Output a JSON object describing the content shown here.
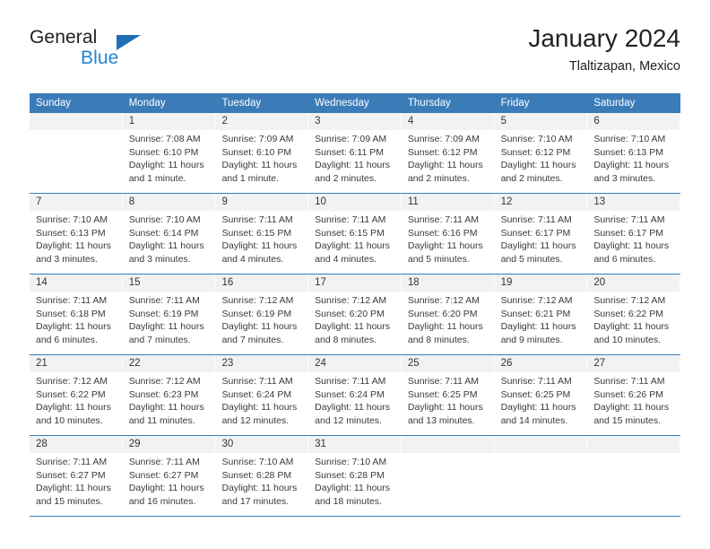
{
  "brand": {
    "name_top": "General",
    "name_bottom": "Blue",
    "triangle_color": "#1f6fb5",
    "blue_color": "#2185d0"
  },
  "header": {
    "title": "January 2024",
    "subtitle": "Tlaltizapan, Mexico"
  },
  "calendar": {
    "header_bg": "#3b7cb8",
    "header_text_color": "#ffffff",
    "daynum_bg": "#f2f2f2",
    "weekdays": [
      "Sunday",
      "Monday",
      "Tuesday",
      "Wednesday",
      "Thursday",
      "Friday",
      "Saturday"
    ],
    "weeks": [
      [
        {
          "day": "",
          "sunrise": "",
          "sunset": "",
          "daylight": "",
          "empty": true
        },
        {
          "day": "1",
          "sunrise": "Sunrise: 7:08 AM",
          "sunset": "Sunset: 6:10 PM",
          "daylight": "Daylight: 11 hours and 1 minute."
        },
        {
          "day": "2",
          "sunrise": "Sunrise: 7:09 AM",
          "sunset": "Sunset: 6:10 PM",
          "daylight": "Daylight: 11 hours and 1 minute."
        },
        {
          "day": "3",
          "sunrise": "Sunrise: 7:09 AM",
          "sunset": "Sunset: 6:11 PM",
          "daylight": "Daylight: 11 hours and 2 minutes."
        },
        {
          "day": "4",
          "sunrise": "Sunrise: 7:09 AM",
          "sunset": "Sunset: 6:12 PM",
          "daylight": "Daylight: 11 hours and 2 minutes."
        },
        {
          "day": "5",
          "sunrise": "Sunrise: 7:10 AM",
          "sunset": "Sunset: 6:12 PM",
          "daylight": "Daylight: 11 hours and 2 minutes."
        },
        {
          "day": "6",
          "sunrise": "Sunrise: 7:10 AM",
          "sunset": "Sunset: 6:13 PM",
          "daylight": "Daylight: 11 hours and 3 minutes."
        }
      ],
      [
        {
          "day": "7",
          "sunrise": "Sunrise: 7:10 AM",
          "sunset": "Sunset: 6:13 PM",
          "daylight": "Daylight: 11 hours and 3 minutes."
        },
        {
          "day": "8",
          "sunrise": "Sunrise: 7:10 AM",
          "sunset": "Sunset: 6:14 PM",
          "daylight": "Daylight: 11 hours and 3 minutes."
        },
        {
          "day": "9",
          "sunrise": "Sunrise: 7:11 AM",
          "sunset": "Sunset: 6:15 PM",
          "daylight": "Daylight: 11 hours and 4 minutes."
        },
        {
          "day": "10",
          "sunrise": "Sunrise: 7:11 AM",
          "sunset": "Sunset: 6:15 PM",
          "daylight": "Daylight: 11 hours and 4 minutes."
        },
        {
          "day": "11",
          "sunrise": "Sunrise: 7:11 AM",
          "sunset": "Sunset: 6:16 PM",
          "daylight": "Daylight: 11 hours and 5 minutes."
        },
        {
          "day": "12",
          "sunrise": "Sunrise: 7:11 AM",
          "sunset": "Sunset: 6:17 PM",
          "daylight": "Daylight: 11 hours and 5 minutes."
        },
        {
          "day": "13",
          "sunrise": "Sunrise: 7:11 AM",
          "sunset": "Sunset: 6:17 PM",
          "daylight": "Daylight: 11 hours and 6 minutes."
        }
      ],
      [
        {
          "day": "14",
          "sunrise": "Sunrise: 7:11 AM",
          "sunset": "Sunset: 6:18 PM",
          "daylight": "Daylight: 11 hours and 6 minutes."
        },
        {
          "day": "15",
          "sunrise": "Sunrise: 7:11 AM",
          "sunset": "Sunset: 6:19 PM",
          "daylight": "Daylight: 11 hours and 7 minutes."
        },
        {
          "day": "16",
          "sunrise": "Sunrise: 7:12 AM",
          "sunset": "Sunset: 6:19 PM",
          "daylight": "Daylight: 11 hours and 7 minutes."
        },
        {
          "day": "17",
          "sunrise": "Sunrise: 7:12 AM",
          "sunset": "Sunset: 6:20 PM",
          "daylight": "Daylight: 11 hours and 8 minutes."
        },
        {
          "day": "18",
          "sunrise": "Sunrise: 7:12 AM",
          "sunset": "Sunset: 6:20 PM",
          "daylight": "Daylight: 11 hours and 8 minutes."
        },
        {
          "day": "19",
          "sunrise": "Sunrise: 7:12 AM",
          "sunset": "Sunset: 6:21 PM",
          "daylight": "Daylight: 11 hours and 9 minutes."
        },
        {
          "day": "20",
          "sunrise": "Sunrise: 7:12 AM",
          "sunset": "Sunset: 6:22 PM",
          "daylight": "Daylight: 11 hours and 10 minutes."
        }
      ],
      [
        {
          "day": "21",
          "sunrise": "Sunrise: 7:12 AM",
          "sunset": "Sunset: 6:22 PM",
          "daylight": "Daylight: 11 hours and 10 minutes."
        },
        {
          "day": "22",
          "sunrise": "Sunrise: 7:12 AM",
          "sunset": "Sunset: 6:23 PM",
          "daylight": "Daylight: 11 hours and 11 minutes."
        },
        {
          "day": "23",
          "sunrise": "Sunrise: 7:11 AM",
          "sunset": "Sunset: 6:24 PM",
          "daylight": "Daylight: 11 hours and 12 minutes."
        },
        {
          "day": "24",
          "sunrise": "Sunrise: 7:11 AM",
          "sunset": "Sunset: 6:24 PM",
          "daylight": "Daylight: 11 hours and 12 minutes."
        },
        {
          "day": "25",
          "sunrise": "Sunrise: 7:11 AM",
          "sunset": "Sunset: 6:25 PM",
          "daylight": "Daylight: 11 hours and 13 minutes."
        },
        {
          "day": "26",
          "sunrise": "Sunrise: 7:11 AM",
          "sunset": "Sunset: 6:25 PM",
          "daylight": "Daylight: 11 hours and 14 minutes."
        },
        {
          "day": "27",
          "sunrise": "Sunrise: 7:11 AM",
          "sunset": "Sunset: 6:26 PM",
          "daylight": "Daylight: 11 hours and 15 minutes."
        }
      ],
      [
        {
          "day": "28",
          "sunrise": "Sunrise: 7:11 AM",
          "sunset": "Sunset: 6:27 PM",
          "daylight": "Daylight: 11 hours and 15 minutes."
        },
        {
          "day": "29",
          "sunrise": "Sunrise: 7:11 AM",
          "sunset": "Sunset: 6:27 PM",
          "daylight": "Daylight: 11 hours and 16 minutes."
        },
        {
          "day": "30",
          "sunrise": "Sunrise: 7:10 AM",
          "sunset": "Sunset: 6:28 PM",
          "daylight": "Daylight: 11 hours and 17 minutes."
        },
        {
          "day": "31",
          "sunrise": "Sunrise: 7:10 AM",
          "sunset": "Sunset: 6:28 PM",
          "daylight": "Daylight: 11 hours and 18 minutes."
        },
        {
          "day": "",
          "sunrise": "",
          "sunset": "",
          "daylight": "",
          "empty": true
        },
        {
          "day": "",
          "sunrise": "",
          "sunset": "",
          "daylight": "",
          "empty": true
        },
        {
          "day": "",
          "sunrise": "",
          "sunset": "",
          "daylight": "",
          "empty": true
        }
      ]
    ]
  }
}
